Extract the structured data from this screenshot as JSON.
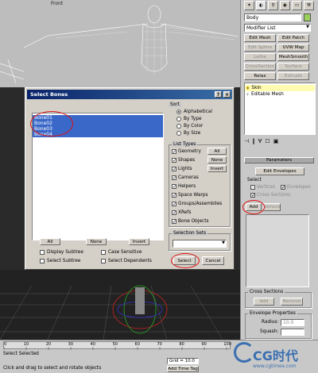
{
  "viewport": {
    "front_label": "Front"
  },
  "dialog": {
    "title": "Select Bones",
    "help_btn": "?",
    "close_btn": "×",
    "bones": [
      "Bone01",
      "Bone02",
      "Bone03",
      "Bone04"
    ],
    "all": "All",
    "none": "None",
    "invert": "Invert",
    "display_subtree": "Display Subtree",
    "case_sensitive": "Case Sensitive",
    "select_subtree": "Select Subtree",
    "select_dependents": "Select Dependents",
    "sort": {
      "title": "Sort",
      "options": [
        "Alphabetical",
        "By Type",
        "By Color",
        "By Size"
      ]
    },
    "list_types": {
      "title": "List Types",
      "items": [
        "Geometry",
        "Shapes",
        "Lights",
        "Cameras",
        "Helpers",
        "Space Warps",
        "Groups/Assemblies",
        "XRefs",
        "Bone Objects"
      ],
      "all": "All",
      "none": "None",
      "invert": "Invert"
    },
    "selection_sets": "Selection Sets",
    "select": "Select",
    "cancel": "Cancel"
  },
  "cmd": {
    "object_name": "Body",
    "modifier_list": "Modifier List",
    "buttons": [
      "Edit Mesh",
      "Edit Patch",
      "Edit Spline",
      "UVW Map",
      "Lathe",
      "MeshSmooth",
      "CrossSection",
      "Surface",
      "Relax",
      "Extrude"
    ],
    "stack": [
      "Skin",
      "Editable Mesh"
    ],
    "params_title": "Parameters",
    "edit_envelopes": "Edit Envelopes",
    "select_title": "Select",
    "vertices": "Vertices",
    "envelopes": "Envelopes",
    "cross_sections": "Cross Sections",
    "add": "Add",
    "remove": "Remove",
    "cs_title": "Cross Sections",
    "cs_add": "Add",
    "cs_remove": "Remove",
    "env_props": "Envelope Properties",
    "radius_label": "Radius:",
    "radius_value": "10.0",
    "squash_label": "Squash:"
  },
  "status": {
    "selected": "Select Selected",
    "hint": "Click and drag to select and rotate objects",
    "ticks": [
      "0",
      "10",
      "20",
      "30",
      "40",
      "50",
      "60",
      "70",
      "80",
      "90",
      "100"
    ],
    "grid": "Grid = 10.0",
    "add_time_tag": "Add Time Tag",
    "watermark": "CG时代",
    "watermark_sub": "www.cgtimes.com"
  },
  "colors": {
    "selection": "#3a68c9",
    "title_start": "#0a246a",
    "title_end": "#3a6ea5",
    "annotation": "#dd1111",
    "viewport_bg": "#2a2a2a"
  }
}
